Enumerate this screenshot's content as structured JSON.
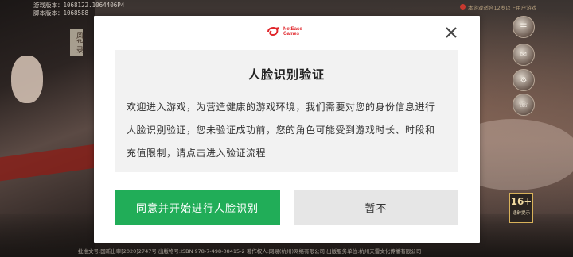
{
  "background": {
    "version_lines": [
      "游戏版本：1068122.1064406P4",
      "脚本版本：1068588"
    ],
    "vertical_tag": "风华录",
    "top_notice": "本游戏适合12岁以上用户游戏",
    "age_badge": {
      "rating": "16+",
      "sub": "适龄提示"
    },
    "footer": "批准文号:国新出审[2020]2747号  出版物号:ISBN 978-7-498-08415-2  著作权人:网易(杭州)网络有限公司  出版服务单位:杭州天雷文化传播有限公司"
  },
  "dialog": {
    "logo_text": [
      "NetEase",
      "Games"
    ],
    "close_icon": "close-icon",
    "title": "人脸识别验证",
    "body_lines": [
      "欢迎进入游戏，为营造健康的游戏环境，我们需要对您的身份信息进行",
      "人脸识别验证，您未验证成功前，您的角色可能受到游戏时长、时段和",
      "充值限制，请点击进入验证流程"
    ],
    "agree_label": "同意并开始进行人脸识别",
    "later_label": "暂不"
  },
  "colors": {
    "agree_button": "#21ad58",
    "later_button": "#e6e6e6",
    "logo_red": "#e0262b",
    "content_box": "#f2f2f2"
  }
}
